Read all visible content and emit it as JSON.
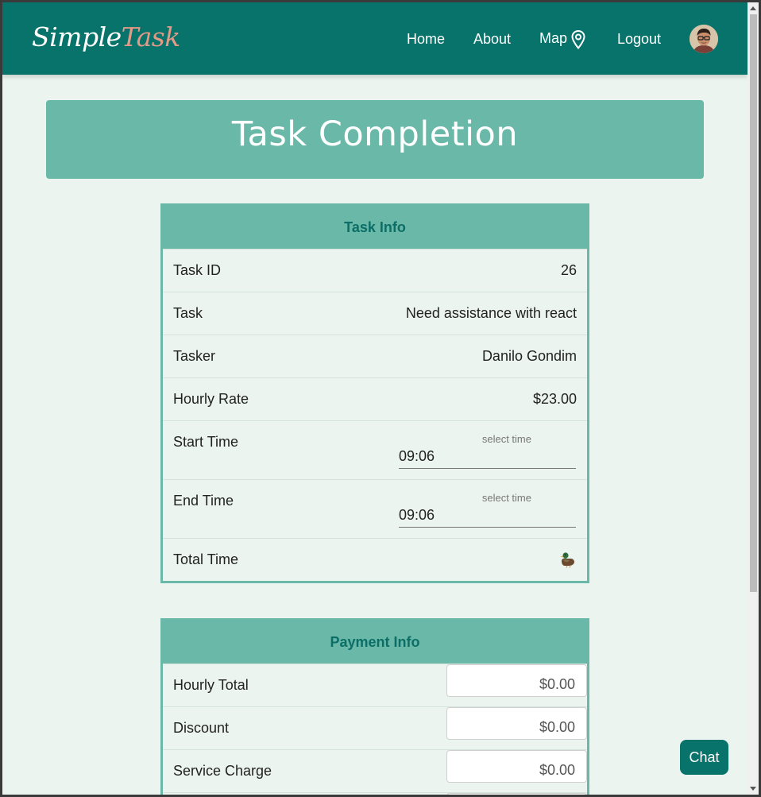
{
  "nav": {
    "brand_part1": "Simple",
    "brand_part2": "Task",
    "home": "Home",
    "about": "About",
    "map": "Map",
    "logout": "Logout"
  },
  "banner": {
    "title": "Task Completion"
  },
  "task_info": {
    "header": "Task Info",
    "rows": [
      {
        "label": "Task ID",
        "value": "26"
      },
      {
        "label": "Task",
        "value": "Need assistance with react"
      },
      {
        "label": "Tasker",
        "value": "Danilo Gondim"
      },
      {
        "label": "Hourly Rate",
        "value": "$23.00"
      }
    ],
    "start_time": {
      "label": "Start Time",
      "caption": "select time",
      "value": "09:06"
    },
    "end_time": {
      "label": "End Time",
      "caption": "select time",
      "value": "09:06"
    },
    "total_time": {
      "label": "Total Time",
      "icon": "duck-icon"
    }
  },
  "payment_info": {
    "header": "Payment Info",
    "rows": [
      {
        "label": "Hourly Total",
        "value": "$0.00"
      },
      {
        "label": "Discount",
        "value": "$0.00"
      },
      {
        "label": "Service Charge",
        "value": "$0.00"
      }
    ]
  },
  "chat": {
    "label": "Chat"
  },
  "colors": {
    "navbar": "#08736b",
    "accent": "#69b8a8",
    "background": "#ebf4ef",
    "brand_highlight": "#e39a87"
  }
}
